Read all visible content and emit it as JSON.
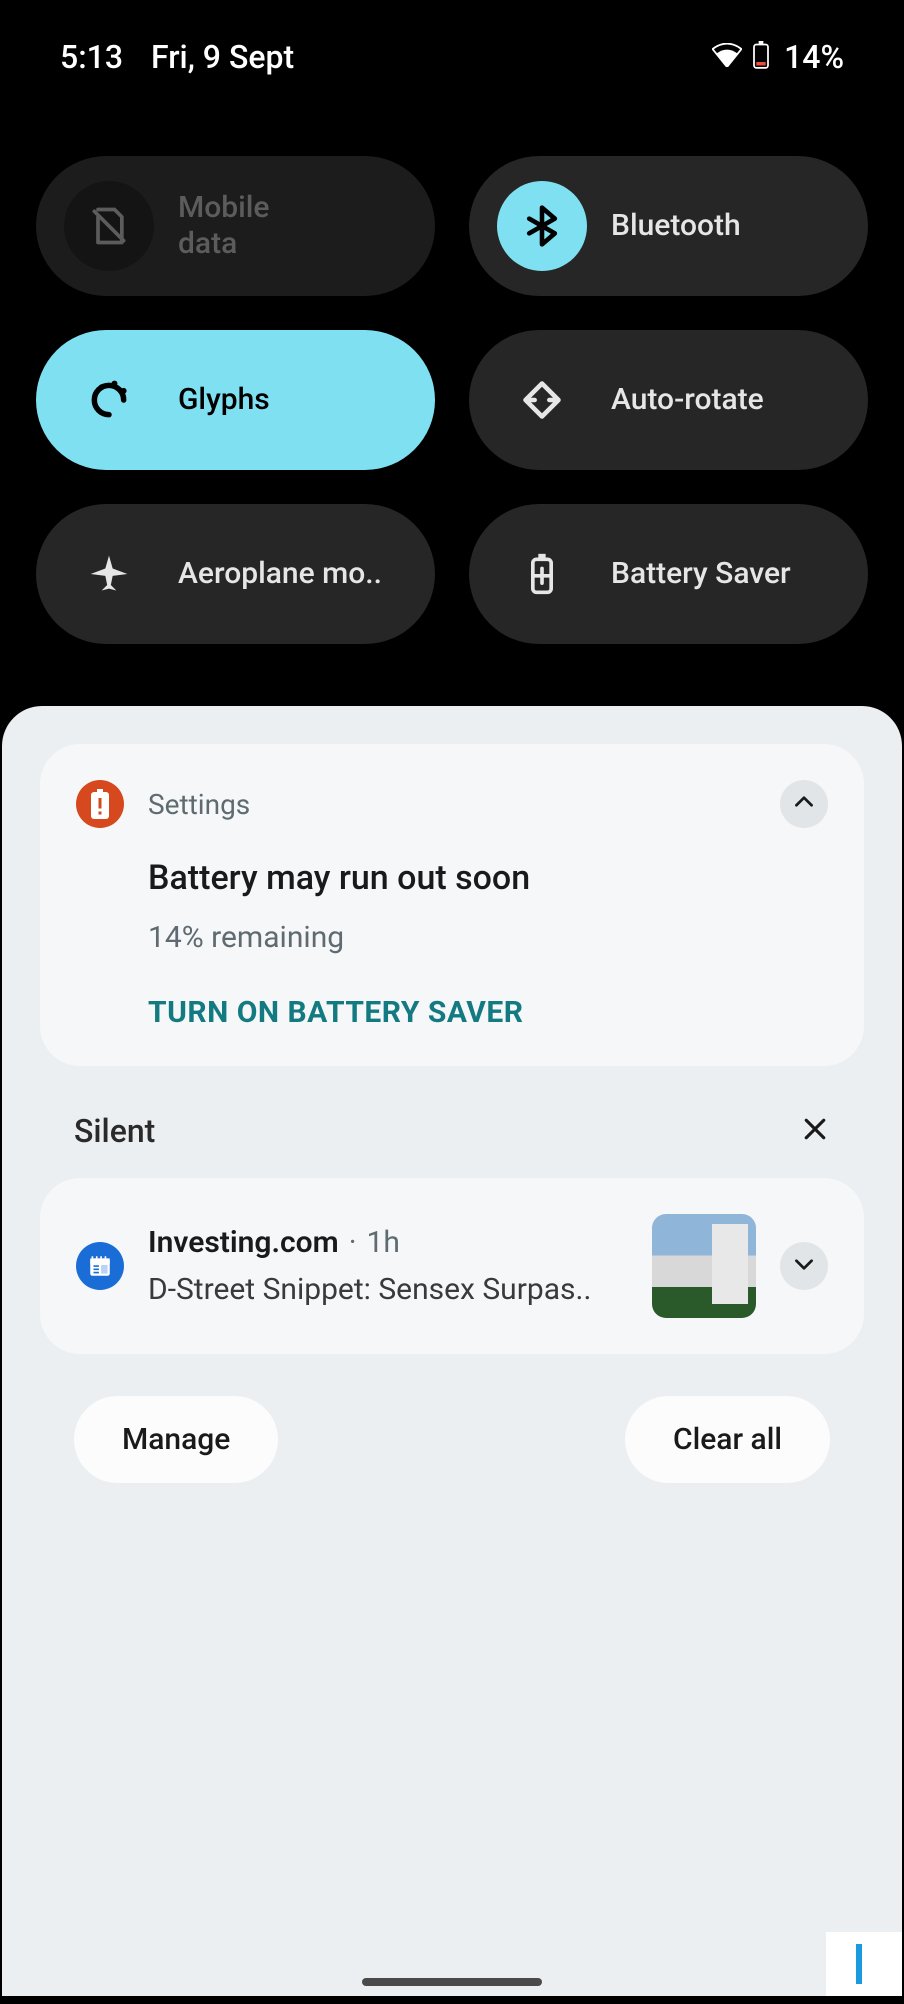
{
  "status": {
    "time": "5:13",
    "date": "Fri, 9 Sept",
    "battery_percent": "14%"
  },
  "quick_settings": {
    "tiles": [
      {
        "label": "Mobile\ndata",
        "state": "disabled",
        "icon": "sim-off"
      },
      {
        "label": "Bluetooth",
        "state": "off",
        "icon": "bluetooth",
        "accent": true
      },
      {
        "label": "Glyphs",
        "state": "on",
        "icon": "glyphs"
      },
      {
        "label": "Auto-rotate",
        "state": "off",
        "icon": "rotate"
      },
      {
        "label": "Aeroplane mo..",
        "state": "off",
        "icon": "airplane"
      },
      {
        "label": "Battery Saver",
        "state": "off",
        "icon": "battery-plus"
      }
    ]
  },
  "notifications": {
    "battery": {
      "app": "Settings",
      "title": "Battery may run out soon",
      "text": "14% remaining",
      "action": "TURN ON BATTERY SAVER"
    },
    "silent_label": "Silent",
    "silent_items": [
      {
        "app": "Investing.com",
        "time_sep": " · ",
        "time": "1h",
        "body": "D-Street Snippet: Sensex Surpas.."
      }
    ],
    "manage_label": "Manage",
    "clear_all_label": "Clear all"
  }
}
